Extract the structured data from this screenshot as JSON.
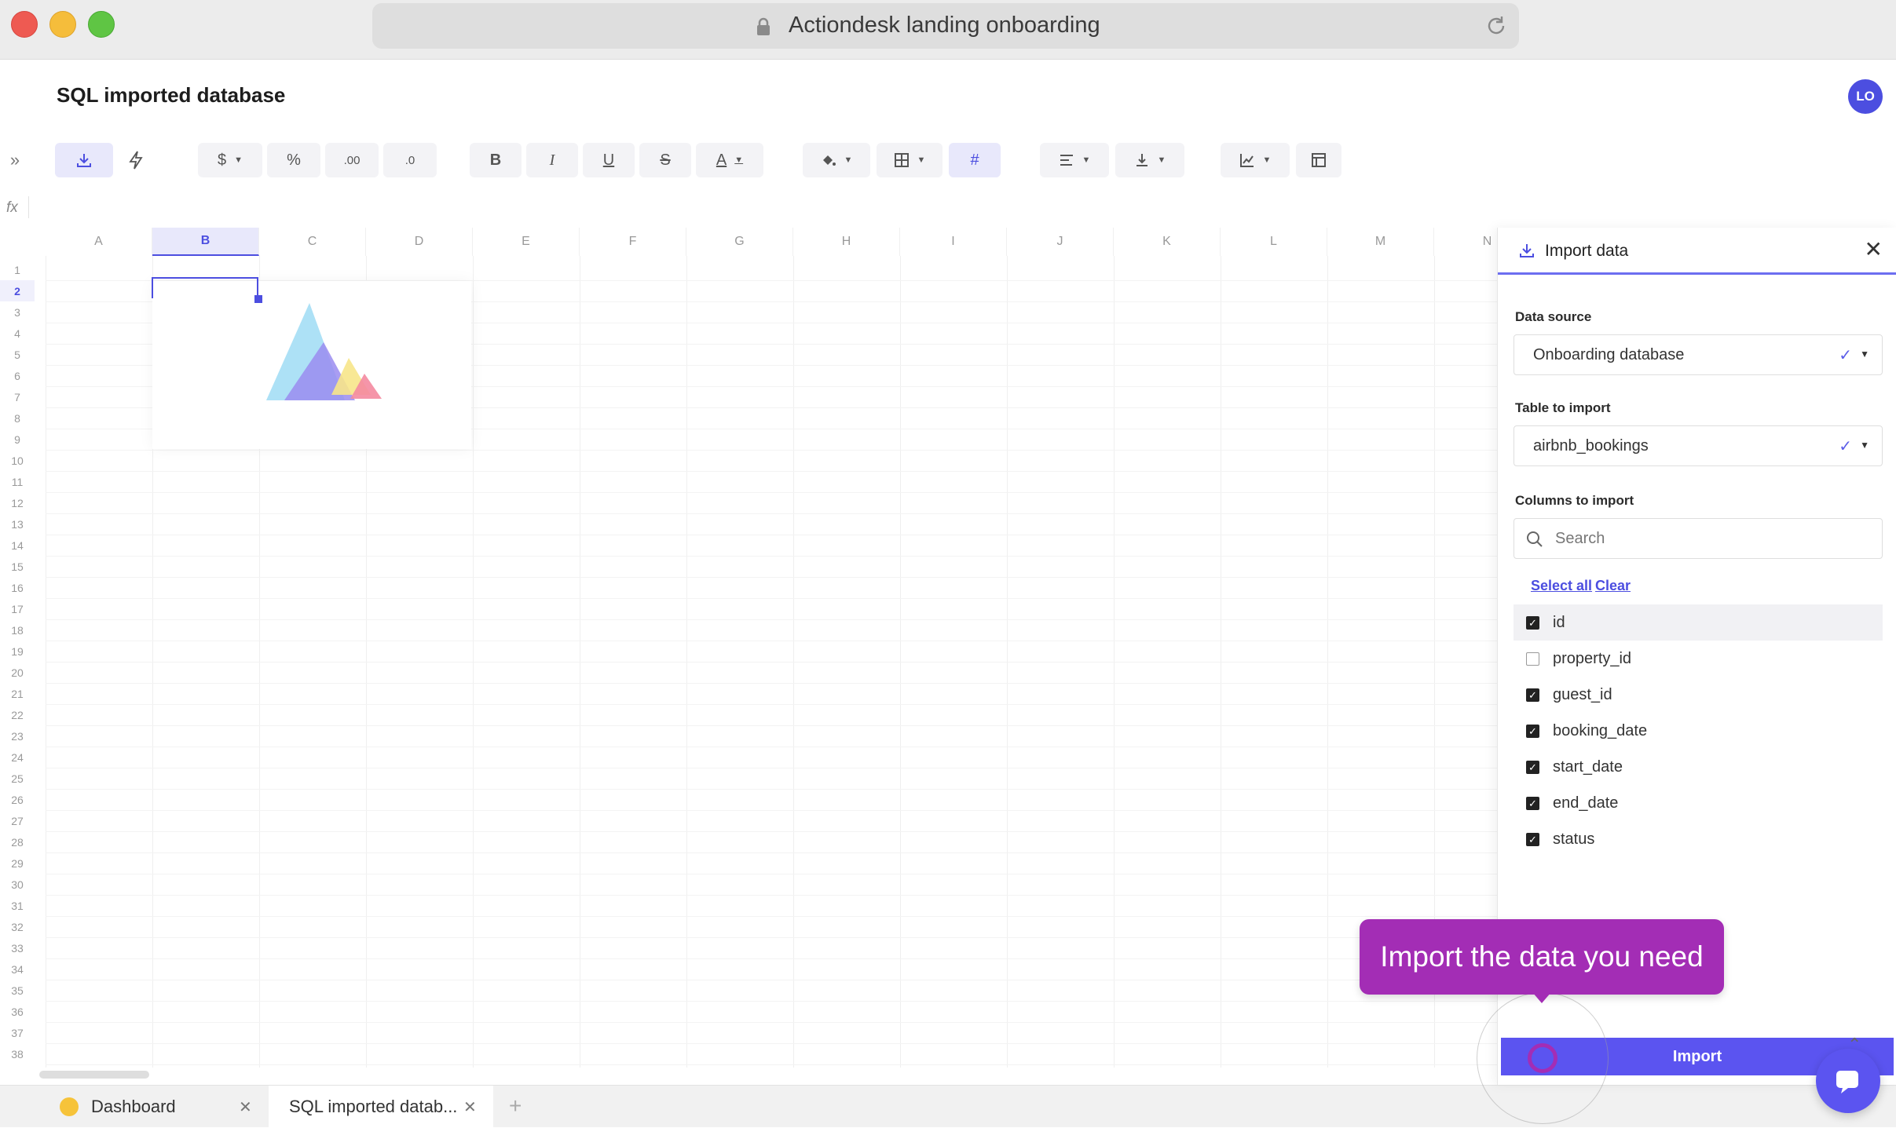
{
  "window": {
    "url_title": "Actiondesk landing onboarding"
  },
  "app": {
    "title": "SQL imported database",
    "avatar_initials": "LO"
  },
  "formula_bar": {
    "label": "fx"
  },
  "toolbar": {
    "currency_label": "$",
    "percent_label": "%",
    "decimals_more_label": ".00",
    "decimals_less_label": ".0",
    "bold_label": "B",
    "italic_label": "I",
    "underline_label": "U",
    "strike_label": "S",
    "text_color_label": "A",
    "hash_label": "#"
  },
  "grid": {
    "columns": [
      "A",
      "B",
      "C",
      "D",
      "E",
      "F",
      "G",
      "H",
      "I",
      "J",
      "K",
      "L",
      "M",
      "N"
    ],
    "selected_column": "B",
    "rows": [
      "1",
      "2",
      "3",
      "4",
      "5",
      "6",
      "7",
      "8",
      "9",
      "10",
      "11",
      "12",
      "13",
      "14",
      "15",
      "16",
      "17",
      "18",
      "19",
      "20",
      "21",
      "22",
      "23",
      "24",
      "25",
      "26",
      "27",
      "28",
      "29",
      "30",
      "31",
      "32",
      "33",
      "34",
      "35",
      "36",
      "37",
      "38"
    ],
    "selected_row": "2"
  },
  "sheet_tabs": [
    {
      "label": "Dashboard",
      "active": false
    },
    {
      "label": "SQL imported datab...",
      "active": true
    }
  ],
  "add_tab_label": "+",
  "import_panel": {
    "title": "Import data",
    "close_label": "✕",
    "data_source_label": "Data source",
    "data_source_value": "Onboarding database",
    "table_label": "Table to import",
    "table_value": "airbnb_bookings",
    "columns_label": "Columns to import",
    "search_placeholder": "Search",
    "select_all_label": "Select all",
    "clear_label": "Clear",
    "columns": [
      {
        "name": "id",
        "checked": true
      },
      {
        "name": "property_id",
        "checked": false
      },
      {
        "name": "guest_id",
        "checked": true
      },
      {
        "name": "booking_date",
        "checked": true
      },
      {
        "name": "start_date",
        "checked": true
      },
      {
        "name": "end_date",
        "checked": true
      },
      {
        "name": "status",
        "checked": true
      }
    ],
    "import_button_label": "Import"
  },
  "tooltip": {
    "text": "Import the data you need"
  },
  "colors": {
    "accent": "#4c4ee0",
    "import_button": "#5b54f0",
    "tooltip": "#a32db5"
  }
}
